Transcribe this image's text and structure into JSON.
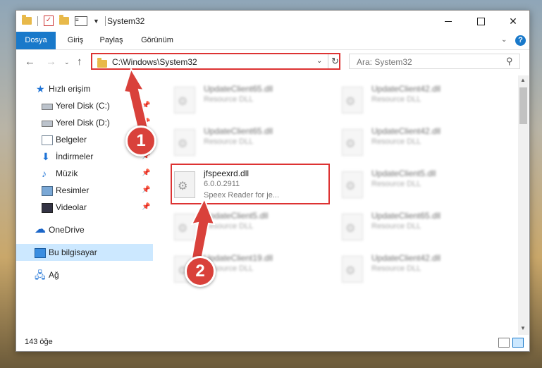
{
  "window": {
    "title": "System32",
    "controls": {
      "minimize": "",
      "maximize": "",
      "close": "✕"
    }
  },
  "ribbon": {
    "tabs": [
      "Dosya",
      "Giriş",
      "Paylaş",
      "Görünüm"
    ],
    "help": "?"
  },
  "nav": {
    "address": "C:\\Windows\\System32",
    "search_placeholder": "Ara: System32"
  },
  "sidebar": {
    "items": [
      {
        "label": "Hızlı erişim",
        "icon": "star-icon"
      },
      {
        "label": "Yerel Disk (C:)",
        "icon": "drive-icon",
        "pinned": true
      },
      {
        "label": "Yerel Disk (D:)",
        "icon": "drive-icon",
        "pinned": true
      },
      {
        "label": "Belgeler",
        "icon": "documents-icon"
      },
      {
        "label": "İndirmeler",
        "icon": "download-icon",
        "pinned": true
      },
      {
        "label": "Müzik",
        "icon": "music-icon",
        "pinned": true
      },
      {
        "label": "Resimler",
        "icon": "pictures-icon",
        "pinned": true
      },
      {
        "label": "Videolar",
        "icon": "videos-icon",
        "pinned": true
      },
      {
        "label": "OneDrive",
        "icon": "onedrive-icon"
      },
      {
        "label": "Bu bilgisayar",
        "icon": "this-pc-icon",
        "selected": true
      },
      {
        "label": "Ağ",
        "icon": "network-icon"
      }
    ]
  },
  "files": [
    {
      "name": "UpdateClient65.dll",
      "desc": "Resource DLL"
    },
    {
      "name": "UpdateClient42.dll",
      "desc": "Resource DLL"
    },
    {
      "name": "UpdateClient65.dll",
      "desc": "Resource DLL"
    },
    {
      "name": "UpdateClient42.dll",
      "desc": "Resource DLL"
    },
    {
      "name": "jfspeexrd.dll",
      "version": "6.0.0.2911",
      "desc": "Speex Reader for je..."
    },
    {
      "name": "UpdateClient5.dll",
      "desc": "Resource DLL"
    },
    {
      "name": "UpdateClient5.dll",
      "desc": "Resource DLL"
    },
    {
      "name": "UpdateClient65.dll",
      "desc": "Resource DLL"
    },
    {
      "name": "UpdateClient19.dll",
      "desc": "Resource DLL"
    },
    {
      "name": "UpdateClient42.dll",
      "desc": "Resource DLL"
    }
  ],
  "status": {
    "count": "143 öğe"
  },
  "annotations": {
    "step1": "1",
    "step2": "2",
    "color": "#d9413b"
  }
}
